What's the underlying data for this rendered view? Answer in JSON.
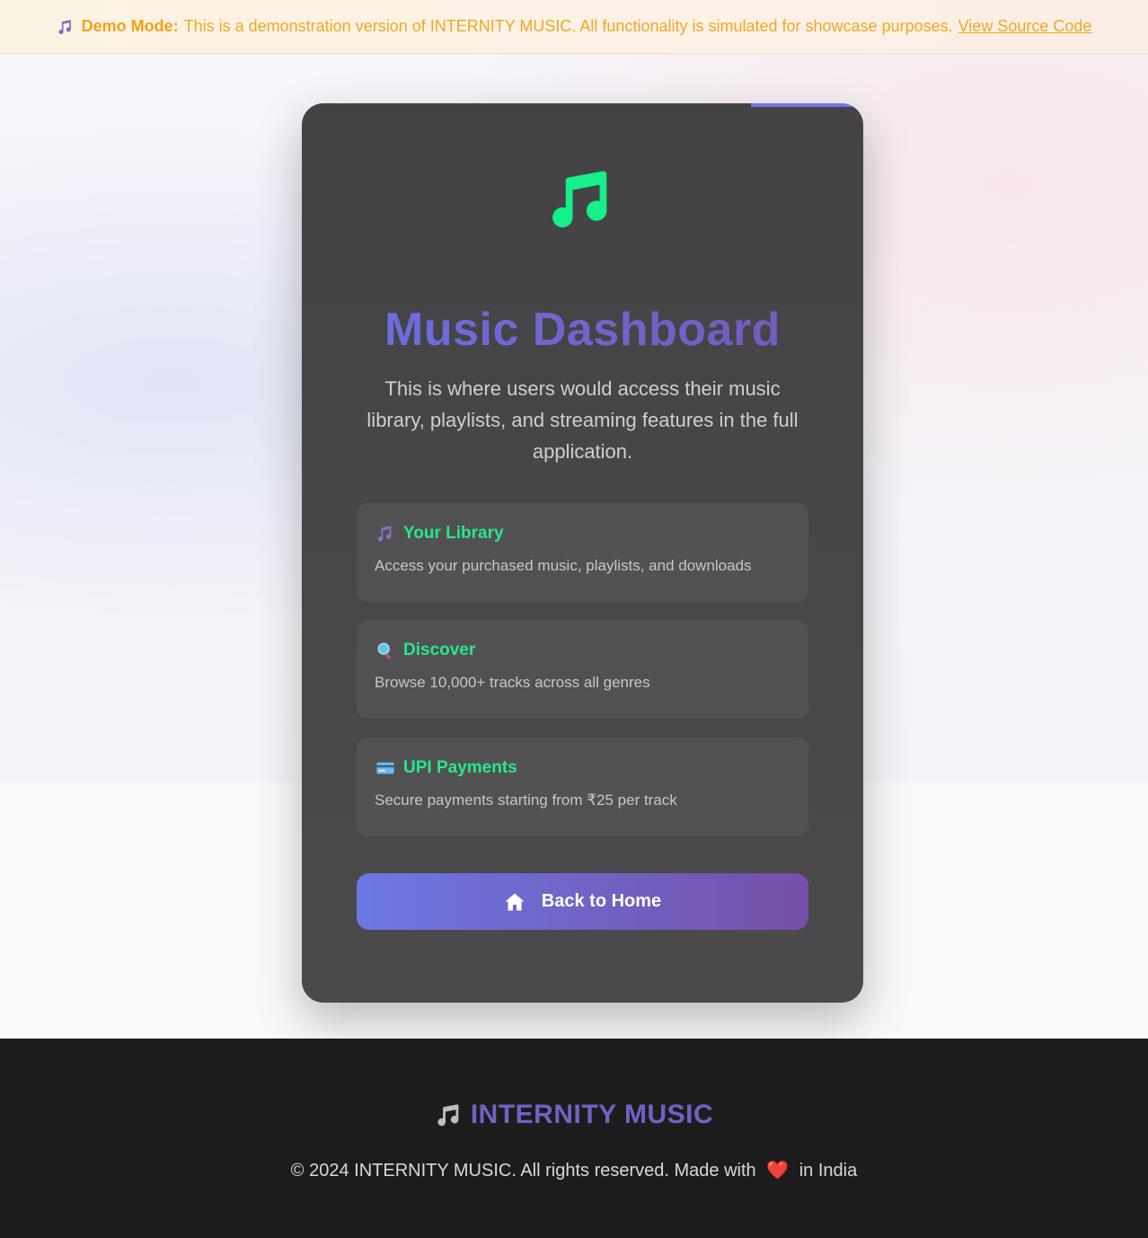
{
  "banner": {
    "label": "Demo Mode:",
    "message": "This is a demonstration version of INTERNITY MUSIC. All functionality is simulated for showcase purposes.",
    "link": "View Source Code",
    "icon": "music-note-icon"
  },
  "card": {
    "icon": "music-note-icon",
    "title": "Music Dashboard",
    "description": "This is where users would access their music library, playlists, and streaming features in the full application.",
    "features": [
      {
        "icon": "music-note-icon",
        "title": "Your Library",
        "text": "Access your purchased music, playlists, and downloads"
      },
      {
        "icon": "magnifier-icon",
        "title": "Discover",
        "text": "Browse 10,000+ tracks across all genres"
      },
      {
        "icon": "credit-card-icon",
        "title": "UPI Payments",
        "text": "Secure payments starting from ₹25 per track"
      }
    ],
    "button": {
      "icon": "home-icon",
      "label": "Back to Home"
    }
  },
  "footer": {
    "brand": "INTERNITY MUSIC",
    "brand_icon": "music-note-icon",
    "copyright_before": "© 2024 INTERNITY MUSIC. All rights reserved. Made with",
    "heart": "❤️",
    "copyright_after": "in India"
  },
  "colors": {
    "accent_green": "#27e88b",
    "accent_purple": "#6a72e3",
    "banner_text": "#f3a21b",
    "card_bg": "#454547",
    "footer_bg": "#1c1c1c"
  }
}
